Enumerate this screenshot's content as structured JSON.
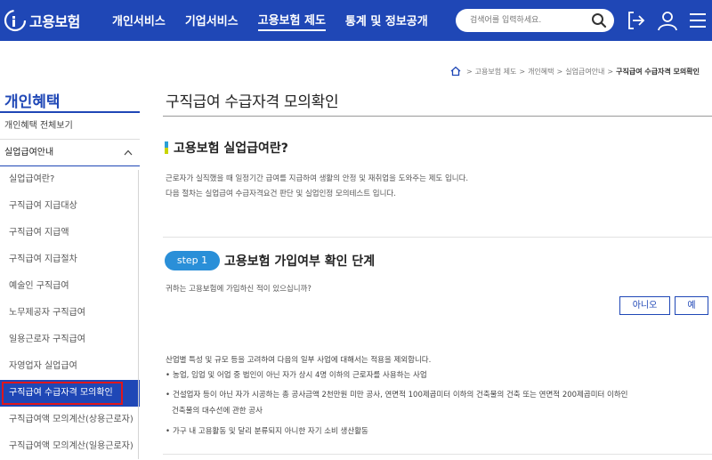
{
  "header": {
    "logo_text": "고용보험",
    "nav": [
      "개인서비스",
      "기업서비스",
      "고용보험 제도",
      "통계 및 정보공개"
    ],
    "search_placeholder": "검색어를 입력하세요.",
    "brand_color": "#1f47b6"
  },
  "breadcrumb": [
    "고용보험 제도",
    "개인혜택",
    "실업급여안내",
    "구직급여 수급자격 모의확인"
  ],
  "sidebar": {
    "title": "개인혜택",
    "overview": "개인혜택 전체보기",
    "section": "실업급여안내",
    "items": [
      "실업급여란?",
      "구직급여 지급대상",
      "구직급여 지급액",
      "구직급여 지급절차",
      "예술인 구직급여",
      "노무제공자 구직급여",
      "일용근로자 구직급여",
      "자영업자 실업급여",
      "구직급여 수급자격 모의확인",
      "구직급여액 모의계산(상용근로자)",
      "구직급여액 모의계산(일용근로자)"
    ]
  },
  "main": {
    "title": "구직급여 수급자격 모의확인",
    "section_title": "고용보험 실업급여란?",
    "desc1": "근로자가 실직했을 때 일정기간 급여를 지급하여 생활의 안정 및 재취업을 도와주는 제도 입니다.",
    "desc2": "다음 절차는 실업급여 수급자격요건 판단 및 실업인정 모의테스트 입니다.",
    "step_label": "step 1",
    "step_title": "고용보험 가입여부 확인 단계",
    "question": "귀하는 고용보험에 가입하신 적이 있으십니까?",
    "btn_no": "아니오",
    "btn_yes": "예",
    "note": "산업별 특성 및 규모 등을 고려하여 다음의 일부 사업에 대해서는 적용을 제외합니다.",
    "bullets": [
      "농업, 임업 및 어업 중 법인이 아닌 자가 상시 4명 이하의 근로자를 사용하는 사업",
      "건설업자 등이 아닌 자가 시공하는 총 공사금액 2천만원 미만 공사, 연면적 100제곱미터 이하의 건축물의 건축 또는 연면적 200제곱미터 이하인",
      "건축물의 대수선에 관한 공사",
      "가구 내 고용활동 및 달리 분류되지 아니한 자기 소비 생산활동"
    ]
  }
}
